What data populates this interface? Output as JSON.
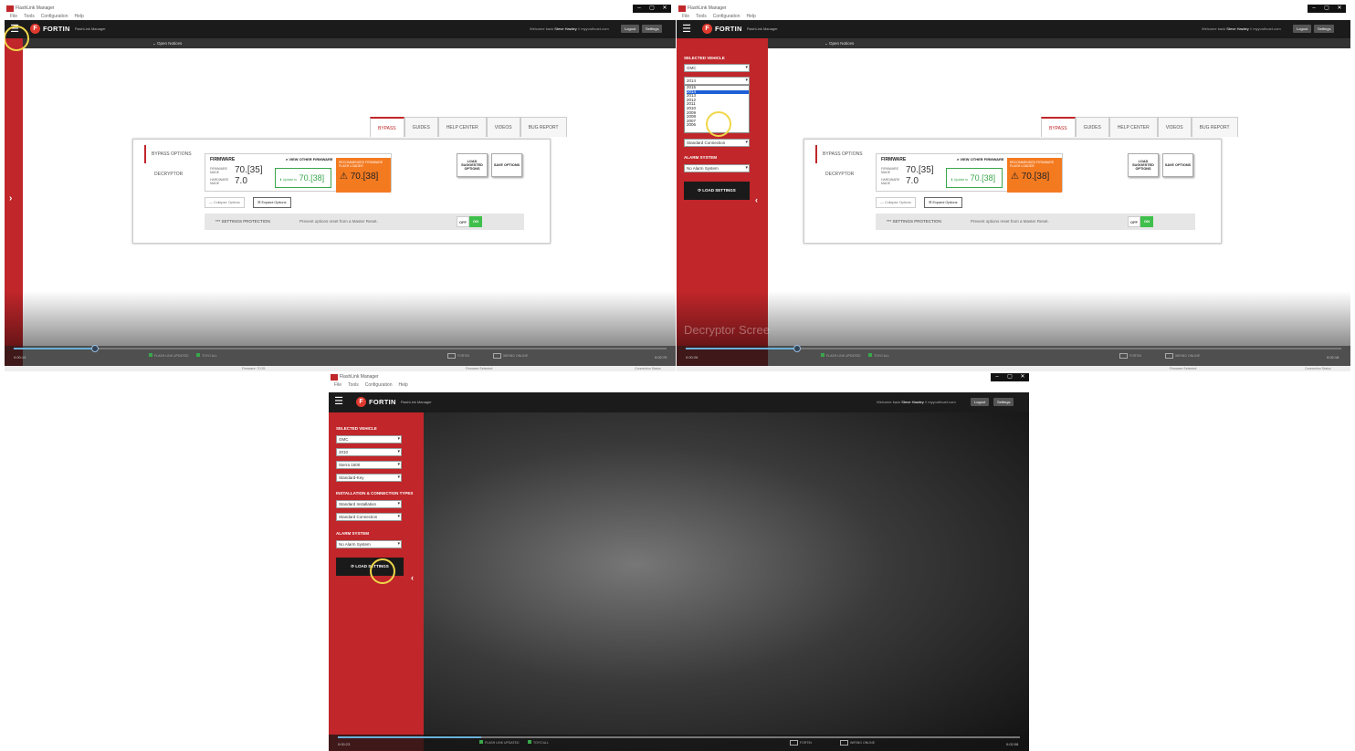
{
  "app": {
    "window_title": "FlashLink Manager",
    "menu": [
      "File",
      "Tools",
      "Configuration",
      "Help"
    ],
    "brand": "FORTIN",
    "product": "FlashLink Manager",
    "welcome_prefix": "Welcome back",
    "user": "Steve Hawley",
    "email": "myyouthcart.com",
    "logout": "Logout",
    "settings": "Settings",
    "open_notices": "Open Notices"
  },
  "tabs": [
    "BYPASS",
    "GUIDES",
    "HELP CENTER",
    "VIDEOS",
    "BUG REPORT"
  ],
  "side_options": [
    "BYPASS OPTIONS",
    "DECRYPTOR"
  ],
  "firmware": {
    "title": "FIRMWARE",
    "view_other": "VIEW OTHER FIRMWARE",
    "firmware_label": "FIRMWARE MADE",
    "firmware_value": "70.[35]",
    "hardware_label": "HARDWARE MADE",
    "hardware_value": "7.0",
    "update_label": "Update to",
    "update_value": "70.[38]",
    "recommended": "RECOMMENDED FIRMWARE FLASH LOADER",
    "recommended_value": "70.[38]"
  },
  "buttons": {
    "load_suggested": "LOAD SUGGESTED OPTIONS",
    "save_options": "SAVE OPTIONS",
    "collapse": "Collapse Options",
    "expand": "Expand Options",
    "load_settings": "LOAD SETTINGS"
  },
  "protection": {
    "label": "*** SETTINGS PROTECTION",
    "desc": "Prevent options reset from a Master Reset.",
    "off": "OFF",
    "on": "ON"
  },
  "vehicle": {
    "section": "SELECTED VEHICLE",
    "make": "GMC",
    "year": "2010",
    "model": "Sierra 1500",
    "key": "Standard-Key",
    "install_section": "INSTALLATION & CONNECTION TYPES",
    "install": "Standard Installation",
    "connection": "Standard Connection",
    "alarm_section": "ALARM SYSTEM",
    "alarm": "No Alarm System",
    "year_options": [
      "2014",
      "2015",
      "2014",
      "2013",
      "2012",
      "2011",
      "2010",
      "2009",
      "2008",
      "2007",
      "2006"
    ]
  },
  "video": {
    "caption": "Decryptor Scree",
    "t1_left": "0:00:13",
    "t1_right": "0:02:70",
    "t2_left": "0:00:26",
    "t2_right": "0:02:18",
    "t3_left": "0:00:23",
    "t3_right": "0:02:08",
    "flash_link": "FLASH LINK UPDATED",
    "fw_mode": "TOYO ALL",
    "fortin": "FORTIN",
    "wiring": "WIRING ONLINE",
    "status_firmware": "Firmware: 70.35",
    "status_selected": "Firmware Selected:",
    "status_conn": "Connection Status"
  }
}
